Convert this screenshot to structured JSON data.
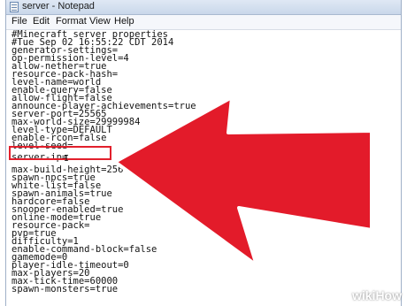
{
  "window": {
    "title": "server - Notepad"
  },
  "menubar": {
    "items": [
      "File",
      "Edit",
      "Format",
      "View",
      "Help"
    ]
  },
  "editor": {
    "lines": [
      "#Minecraft server properties",
      "#Tue Sep 02 16:55:22 CDT 2014",
      "generator-settings=",
      "op-permission-level=4",
      "allow-nether=true",
      "resource-pack-hash=",
      "level-name=world",
      "enable-query=false",
      "allow-flight=false",
      "announce-player-achievements=true",
      "server-port=25565",
      "max-world-size=29999984",
      "level-type=DEFAULT",
      "enable-rcon=false",
      "level-seed=",
      "",
      "server-ip=",
      "",
      "max-build-height=256",
      "spawn-npcs=true",
      "white-list=false",
      "spawn-animals=true",
      "hardcore=false",
      "snooper-enabled=true",
      "online-mode=true",
      "resource-pack=",
      "pvp=true",
      "difficulty=1",
      "enable-command-block=false",
      "gamemode=0",
      "player-idle-timeout=0",
      "max-players=20",
      "max-tick-time=60000",
      "spawn-monsters=true"
    ]
  },
  "annotation": {
    "arrow_color": "#e31b2a"
  },
  "watermark": "wikiHow"
}
